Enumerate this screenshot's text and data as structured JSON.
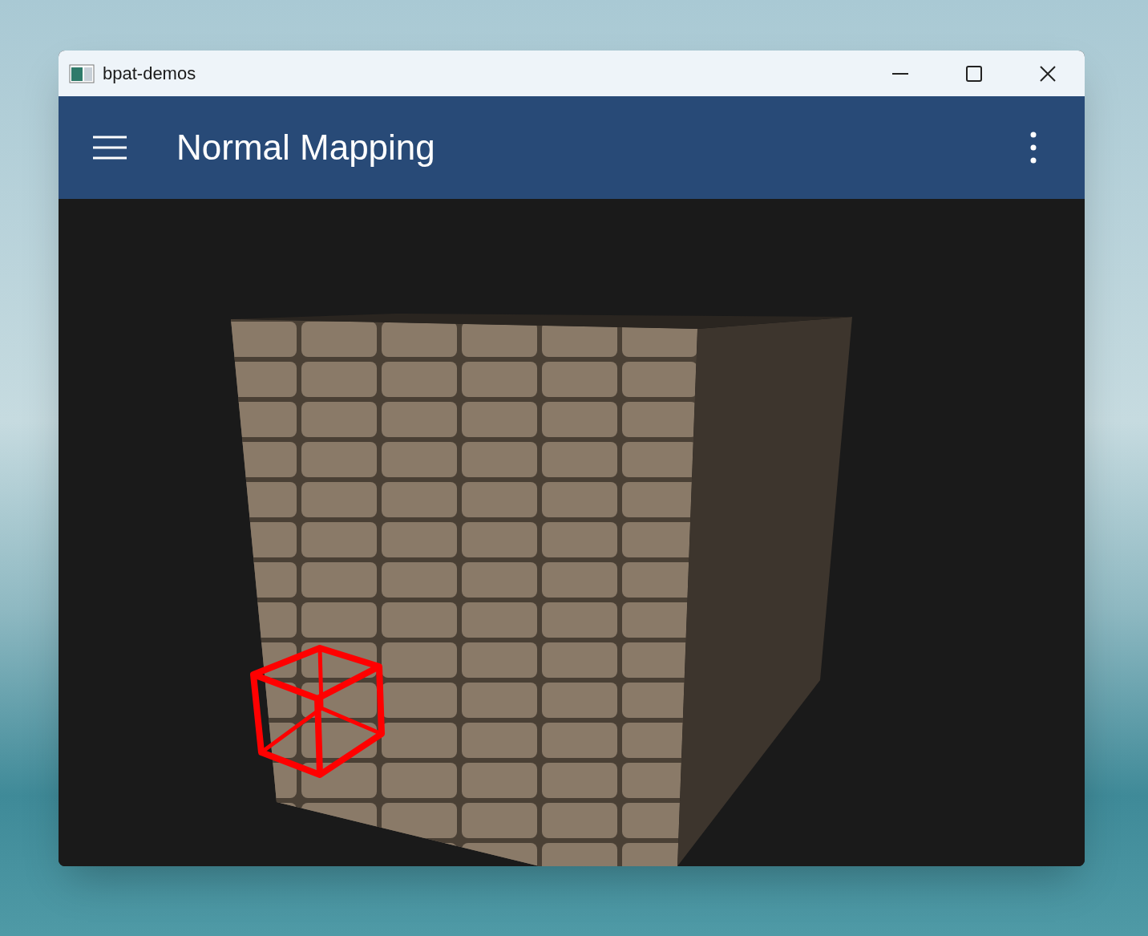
{
  "window": {
    "title": "bpat-demos"
  },
  "app_bar": {
    "title": "Normal Mapping"
  }
}
